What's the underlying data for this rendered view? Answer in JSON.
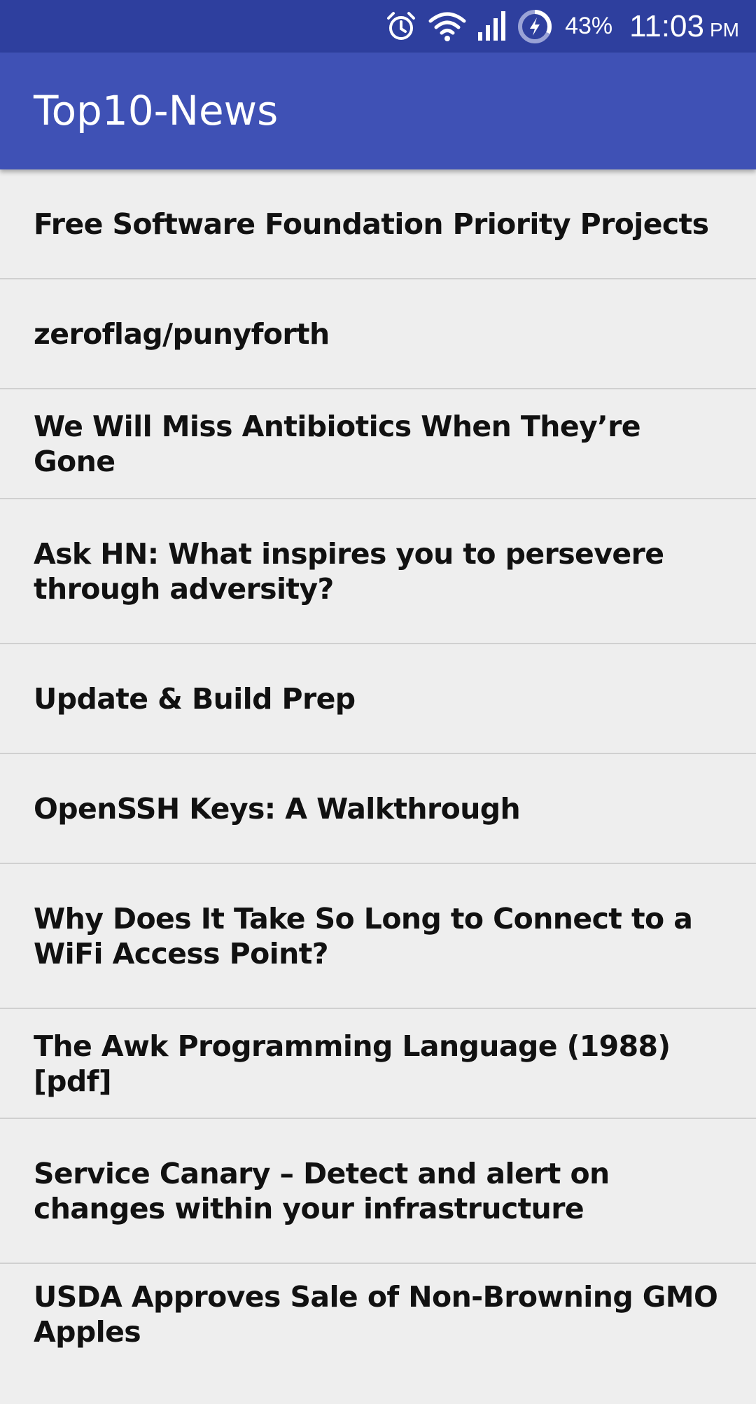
{
  "status_bar": {
    "battery_percent": "43%",
    "time": "11:03",
    "ampm": "PM",
    "icons": [
      "alarm-icon",
      "wifi-icon",
      "signal-icon",
      "battery-charging-icon"
    ]
  },
  "app_bar": {
    "title": "Top10-News",
    "color": "#3f51b5"
  },
  "news": [
    "Free Software Foundation Priority Projects",
    "zeroflag/punyforth",
    "We Will Miss Antibiotics When They’re Gone",
    "Ask HN: What inspires you to persevere through adversity?",
    "Update & Build Prep",
    "OpenSSH Keys: A Walkthrough",
    "Why Does It Take So Long to Connect to a WiFi Access Point?",
    "The Awk Programming Language (1988) [pdf]",
    "Service Canary – Detect and alert on changes within your infrastructure",
    "USDA Approves Sale of Non-Browning GMO Apples"
  ]
}
